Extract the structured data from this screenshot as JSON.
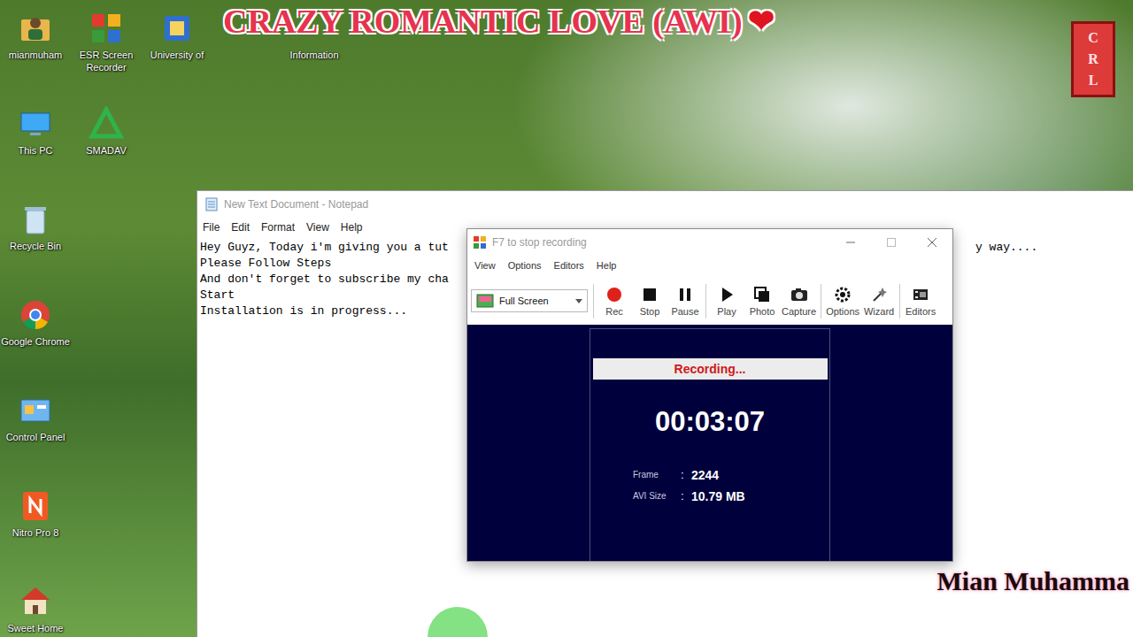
{
  "desktop": {
    "columns": [
      [
        {
          "label": "mianmuham",
          "kind": "user"
        },
        {
          "label": "This PC",
          "kind": "pc"
        },
        {
          "label": "Recycle Bin",
          "kind": "bin"
        },
        {
          "label": "Google Chrome",
          "kind": "chrome"
        },
        {
          "label": "Control Panel",
          "kind": "panel"
        },
        {
          "label": "Nitro Pro 8",
          "kind": "nitro"
        },
        {
          "label": "Sweet Home",
          "kind": "home"
        }
      ],
      [
        {
          "label": "ESR Screen Recorder",
          "kind": "esr"
        },
        {
          "label": "SMADAV",
          "kind": "smadav"
        }
      ],
      [
        {
          "label": "University of",
          "kind": "app"
        }
      ],
      [
        {
          "label": "Information",
          "kind": "hidden"
        }
      ]
    ]
  },
  "banner": {
    "title": "CRAZY ROMANTIC LOVE (AWI)",
    "heart": "❤",
    "badge": "CRL"
  },
  "watermark": "Mian Muhamma",
  "notepad": {
    "title": "New Text Document - Notepad",
    "menu": [
      "File",
      "Edit",
      "Format",
      "View",
      "Help"
    ],
    "lines": [
      {
        "text": "Hey Guyz, Today i'm giving you a tut",
        "tail": "y way...."
      },
      {
        "text": "Please Follow Steps"
      },
      {
        "text": "And don't forget to subscribe my cha"
      },
      {
        "text": "Start"
      },
      {
        "text": "Installation is in progress..."
      }
    ]
  },
  "recorder": {
    "title": "F7 to stop recording",
    "menu": [
      "View",
      "Options",
      "Editors",
      "Help"
    ],
    "source": "Full Screen",
    "tool_groups": [
      [
        {
          "label": "Rec",
          "kind": "rec"
        },
        {
          "label": "Stop",
          "kind": "stop"
        },
        {
          "label": "Pause",
          "kind": "pause"
        }
      ],
      [
        {
          "label": "Play",
          "kind": "play"
        },
        {
          "label": "Photo",
          "kind": "photo"
        },
        {
          "label": "Capture",
          "kind": "capture"
        }
      ],
      [
        {
          "label": "Options",
          "kind": "options"
        },
        {
          "label": "Wizard",
          "kind": "wizard"
        }
      ],
      [
        {
          "label": "Editors",
          "kind": "editors"
        }
      ]
    ],
    "status": "Recording...",
    "time": "00:03:07",
    "stats": [
      {
        "label": "Frame",
        "sep": ":",
        "value": "2244"
      },
      {
        "label": "AVI Size",
        "sep": ":",
        "value": "10.79 MB"
      }
    ]
  }
}
